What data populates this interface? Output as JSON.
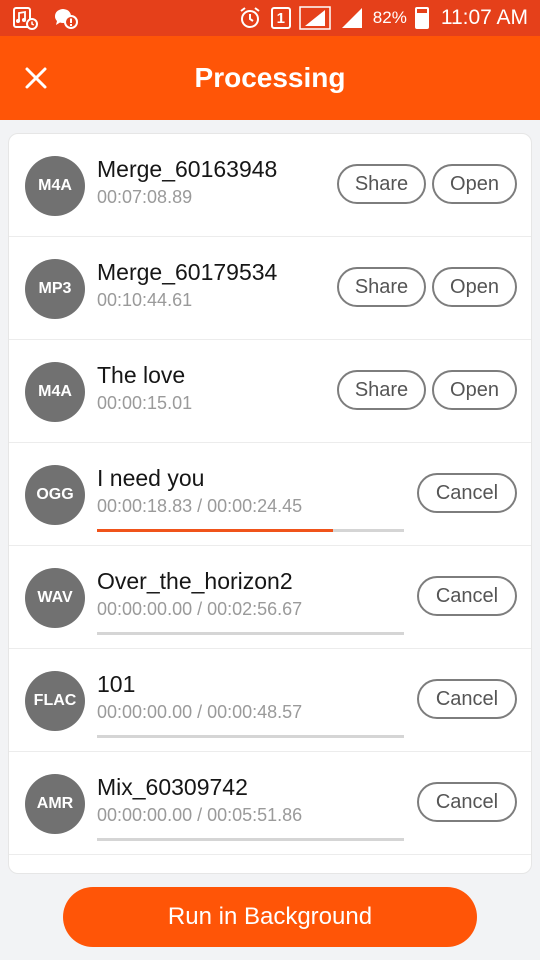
{
  "status_bar": {
    "sim_slot": "1",
    "battery": "82%",
    "time": "11:07 AM"
  },
  "app_bar": {
    "title": "Processing",
    "close_icon": "close-icon"
  },
  "buttons": {
    "share": "Share",
    "open": "Open",
    "cancel": "Cancel",
    "run_background": "Run in Background"
  },
  "items": [
    {
      "format": "M4A",
      "name": "Merge_60163948",
      "time": "00:07:08.89",
      "state": "done"
    },
    {
      "format": "MP3",
      "name": "Merge_60179534",
      "time": "00:10:44.61",
      "state": "done"
    },
    {
      "format": "M4A",
      "name": "The love",
      "time": "00:00:15.01",
      "state": "done"
    },
    {
      "format": "OGG",
      "name": "I need you",
      "time": "00:00:18.83 / 00:00:24.45",
      "state": "processing",
      "progress": 0.77
    },
    {
      "format": "WAV",
      "name": "Over_the_horizon2",
      "time": "00:00:00.00 / 00:02:56.67",
      "state": "processing",
      "progress": 0
    },
    {
      "format": "FLAC",
      "name": "101",
      "time": "00:00:00.00 / 00:00:48.57",
      "state": "processing",
      "progress": 0
    },
    {
      "format": "AMR",
      "name": "Mix_60309742",
      "time": "00:00:00.00 / 00:05:51.86",
      "state": "processing",
      "progress": 0
    }
  ],
  "colors": {
    "status_bar": "#e5401a",
    "accent": "#ff5507",
    "badge": "#717171",
    "progress": "#f0531a"
  }
}
